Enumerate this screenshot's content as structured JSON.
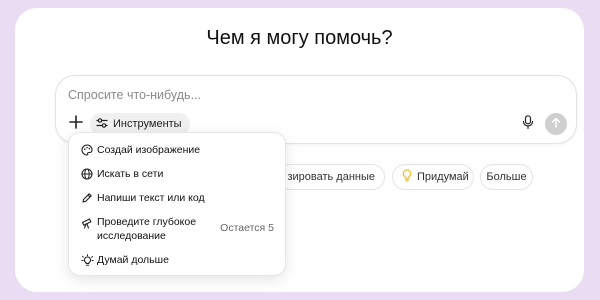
{
  "heading": "Чем я могу помочь?",
  "composer": {
    "placeholder": "Спросите что-нибудь...",
    "tools_label": "Инструменты",
    "icons": {
      "plus": "plus-icon",
      "tools": "sliders-icon",
      "mic": "microphone-icon",
      "send": "arrow-up-icon"
    }
  },
  "suggestions": {
    "analyze_visible": "зировать данные",
    "think": "Придумай",
    "more": "Больше"
  },
  "tools_menu": {
    "items": [
      {
        "label": "Создай изображение",
        "icon": "palette-icon"
      },
      {
        "label": "Искать в сети",
        "icon": "globe-icon"
      },
      {
        "label": "Напиши текст или код",
        "icon": "pen-icon"
      },
      {
        "label": "Проведите глубокое исследование",
        "icon": "telescope-icon",
        "aside": "Остается 5"
      },
      {
        "label": "Думай дольше",
        "icon": "lightbulb-icon"
      }
    ]
  },
  "colors": {
    "background": "#eadcf2",
    "card": "#ffffff",
    "send_disabled": "#cfcfcf",
    "lightbulb": "#f0c23a"
  }
}
